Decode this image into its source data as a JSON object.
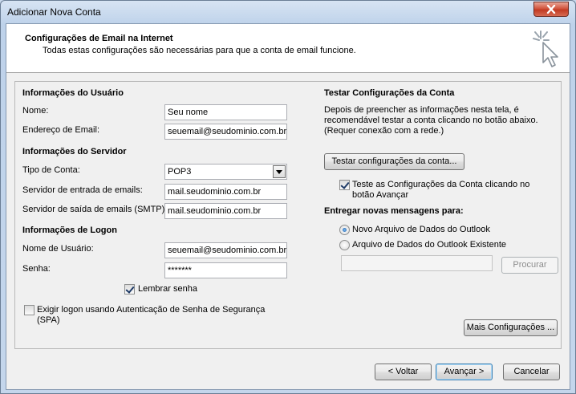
{
  "window": {
    "title": "Adicionar Nova Conta"
  },
  "header": {
    "title": "Configurações de Email na Internet",
    "subtitle": "Todas estas configurações são necessárias para que a conta de email funcione."
  },
  "user_info": {
    "section": "Informações do Usuário",
    "name_label": "Nome:",
    "name_value": "Seu nome",
    "email_label": "Endereço de Email:",
    "email_value": "seuemail@seudominio.com.br"
  },
  "server_info": {
    "section": "Informações do Servidor",
    "account_type_label": "Tipo de Conta:",
    "account_type_value": "POP3",
    "incoming_label": "Servidor de entrada de emails:",
    "incoming_value": "mail.seudominio.com.br",
    "outgoing_label": "Servidor de saída de emails (SMTP):",
    "outgoing_value": "mail.seudominio.com.br"
  },
  "logon_info": {
    "section": "Informações de Logon",
    "username_label": "Nome de Usuário:",
    "username_value": "seuemail@seudominio.com.br",
    "password_label": "Senha:",
    "password_value": "*******",
    "remember_label": "Lembrar senha",
    "remember_checked": true,
    "spa_label_line1": "Exigir logon usando Autenticação de Senha de Segurança",
    "spa_label_line2": "(SPA)",
    "spa_checked": false
  },
  "test": {
    "section": "Testar Configurações da Conta",
    "desc_line1": "Depois de preencher as informações nesta tela, é",
    "desc_line2": "recomendável testar a conta clicando no botão abaixo.",
    "desc_line3": "(Requer conexão com a rede.)",
    "button_label": "Testar configurações da conta...",
    "auto_test_line1": "Teste as Configurações da Conta clicando no",
    "auto_test_line2": "botão Avançar",
    "auto_test_checked": true
  },
  "delivery": {
    "section": "Entregar novas mensagens para:",
    "option_new": "Novo Arquivo de Dados do Outlook",
    "option_existing": "Arquivo de Dados do Outlook Existente",
    "path_value": "",
    "browse_label": "Procurar"
  },
  "more_settings_label": "Mais Configurações ...",
  "footer": {
    "back_label": "< Voltar",
    "next_label": "Avançar >",
    "cancel_label": "Cancelar"
  },
  "icons": {
    "close": "close-icon",
    "header": "cursor-sparkle-icon",
    "combo": "chevron-down-icon"
  }
}
